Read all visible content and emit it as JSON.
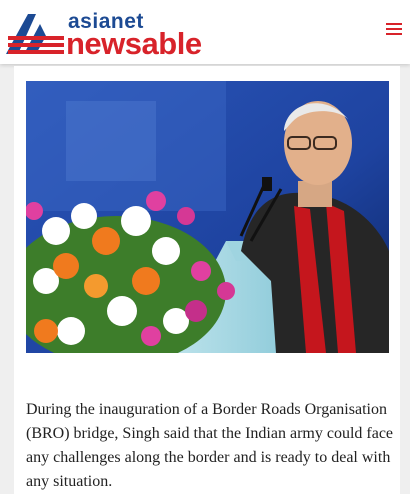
{
  "header": {
    "logo_top": "asianet",
    "logo_bottom": "newsable",
    "logo_icon": "asianet-logo-icon",
    "menu_icon": "hamburger-menu-icon"
  },
  "colors": {
    "brand_blue": "#1c4a93",
    "brand_red": "#d8232a",
    "text": "#222222"
  },
  "article": {
    "image_alt_icon": "article-photo",
    "paragraph": "During the inauguration of a Border Roads Organisation (BRO) bridge, Singh said that the Indian army could face any challenges along the border and is ready to deal with any situation."
  }
}
